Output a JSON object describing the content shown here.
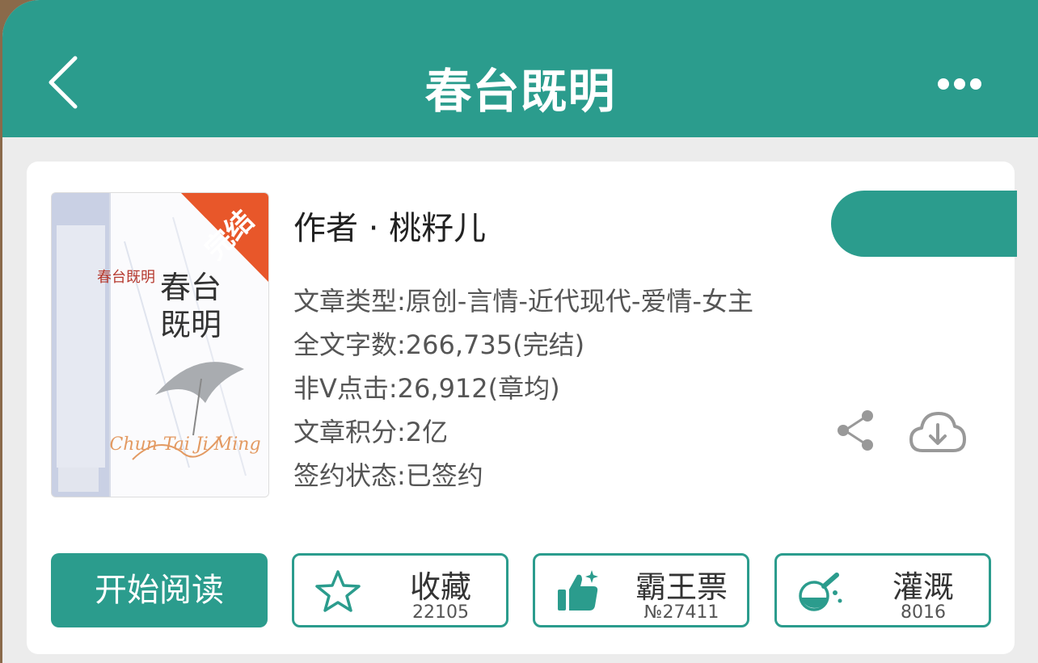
{
  "nav": {
    "title": "春台既明",
    "back_icon": "chevron-left-icon",
    "more_icon": "more-dots-icon"
  },
  "book": {
    "cover": {
      "badge": "完结",
      "title_line1": "春台",
      "title_line2": "既明",
      "script_title": "Chun Tai Ji Ming"
    },
    "author_label": "作者 · 桃籽儿",
    "info": [
      "文章类型:原创-言情-近代现代-爱情-女主",
      "全文字数:266,735(完结)",
      "非Ⅴ点击:26,912(章均)",
      "文章积分:2亿",
      "签约状态:已签约"
    ]
  },
  "actions": {
    "read_label": "开始阅读",
    "favorite": {
      "label": "收藏",
      "count": "22105",
      "icon": "star-icon"
    },
    "vote": {
      "label": "霸王票",
      "count": "№27411",
      "icon": "thumbs-up-icon"
    },
    "nutrient": {
      "label": "灌溉",
      "count": "8016",
      "icon": "flask-icon"
    }
  },
  "colors": {
    "accent": "#2b9c8d",
    "badge": "#e8572a"
  }
}
